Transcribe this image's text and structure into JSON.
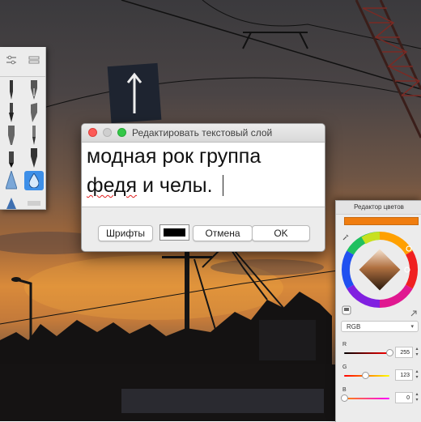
{
  "dialog": {
    "title": "Редактировать текстовый слой",
    "text_line1": "модная рок группа",
    "text_line2_word1": "федя",
    "text_line2_rest": " и челы.",
    "fonts_button": "Шрифты",
    "cancel_button": "Отмена",
    "ok_button": "OK",
    "text_color": "#000000"
  },
  "color_editor": {
    "title": "Редактор цветов",
    "current_color": "#f07d0f",
    "mode": "RGB",
    "channels": [
      {
        "label": "R",
        "value": "255",
        "fraction": 1.0
      },
      {
        "label": "G",
        "value": "123",
        "fraction": 0.48
      },
      {
        "label": "B",
        "value": "0",
        "fraction": 0.0
      }
    ]
  },
  "palette": {
    "tools": [
      "settings-sliders-icon",
      "swap-icon",
      "pen-icon",
      "fountain-pen-icon",
      "brush-icon",
      "calligraphy-pen-icon",
      "marker-icon",
      "thin-brush-icon",
      "crayon-icon",
      "nib-icon",
      "airbrush-icon",
      "water-drop-icon",
      "smudge-icon"
    ],
    "selected_tool": "water-drop-icon"
  }
}
